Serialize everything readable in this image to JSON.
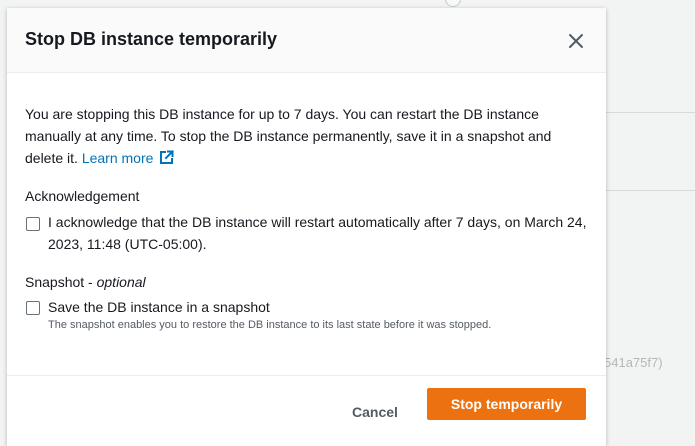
{
  "background": {
    "partial_id": "541a75f7)"
  },
  "modal": {
    "title": "Stop DB instance temporarily",
    "close_icon": "close-icon",
    "description_text": "You are stopping this DB instance for up to 7 days. You can restart the DB instance manually at any time. To stop the DB instance permanently, save it in a snapshot and delete it.",
    "learn_more_label": "Learn more",
    "external_link_icon": "external-link-icon",
    "acknowledgement": {
      "label": "Acknowledgement",
      "checkbox_label": "I acknowledge that the DB instance will restart automatically after 7 days, on March 24, 2023, 11:48 (UTC-05:00).",
      "checked": false
    },
    "snapshot": {
      "label": "Snapshot - ",
      "optional_label": "optional",
      "checkbox_label": "Save the DB instance in a snapshot",
      "checkbox_description": "The snapshot enables you to restore the DB instance to its last state before it was stopped.",
      "checked": false
    },
    "footer": {
      "cancel_label": "Cancel",
      "confirm_label": "Stop temporarily"
    }
  },
  "colors": {
    "primary_button": "#ec7211",
    "link": "#0073bb",
    "text": "#16191f",
    "secondary_text": "#545b64"
  }
}
